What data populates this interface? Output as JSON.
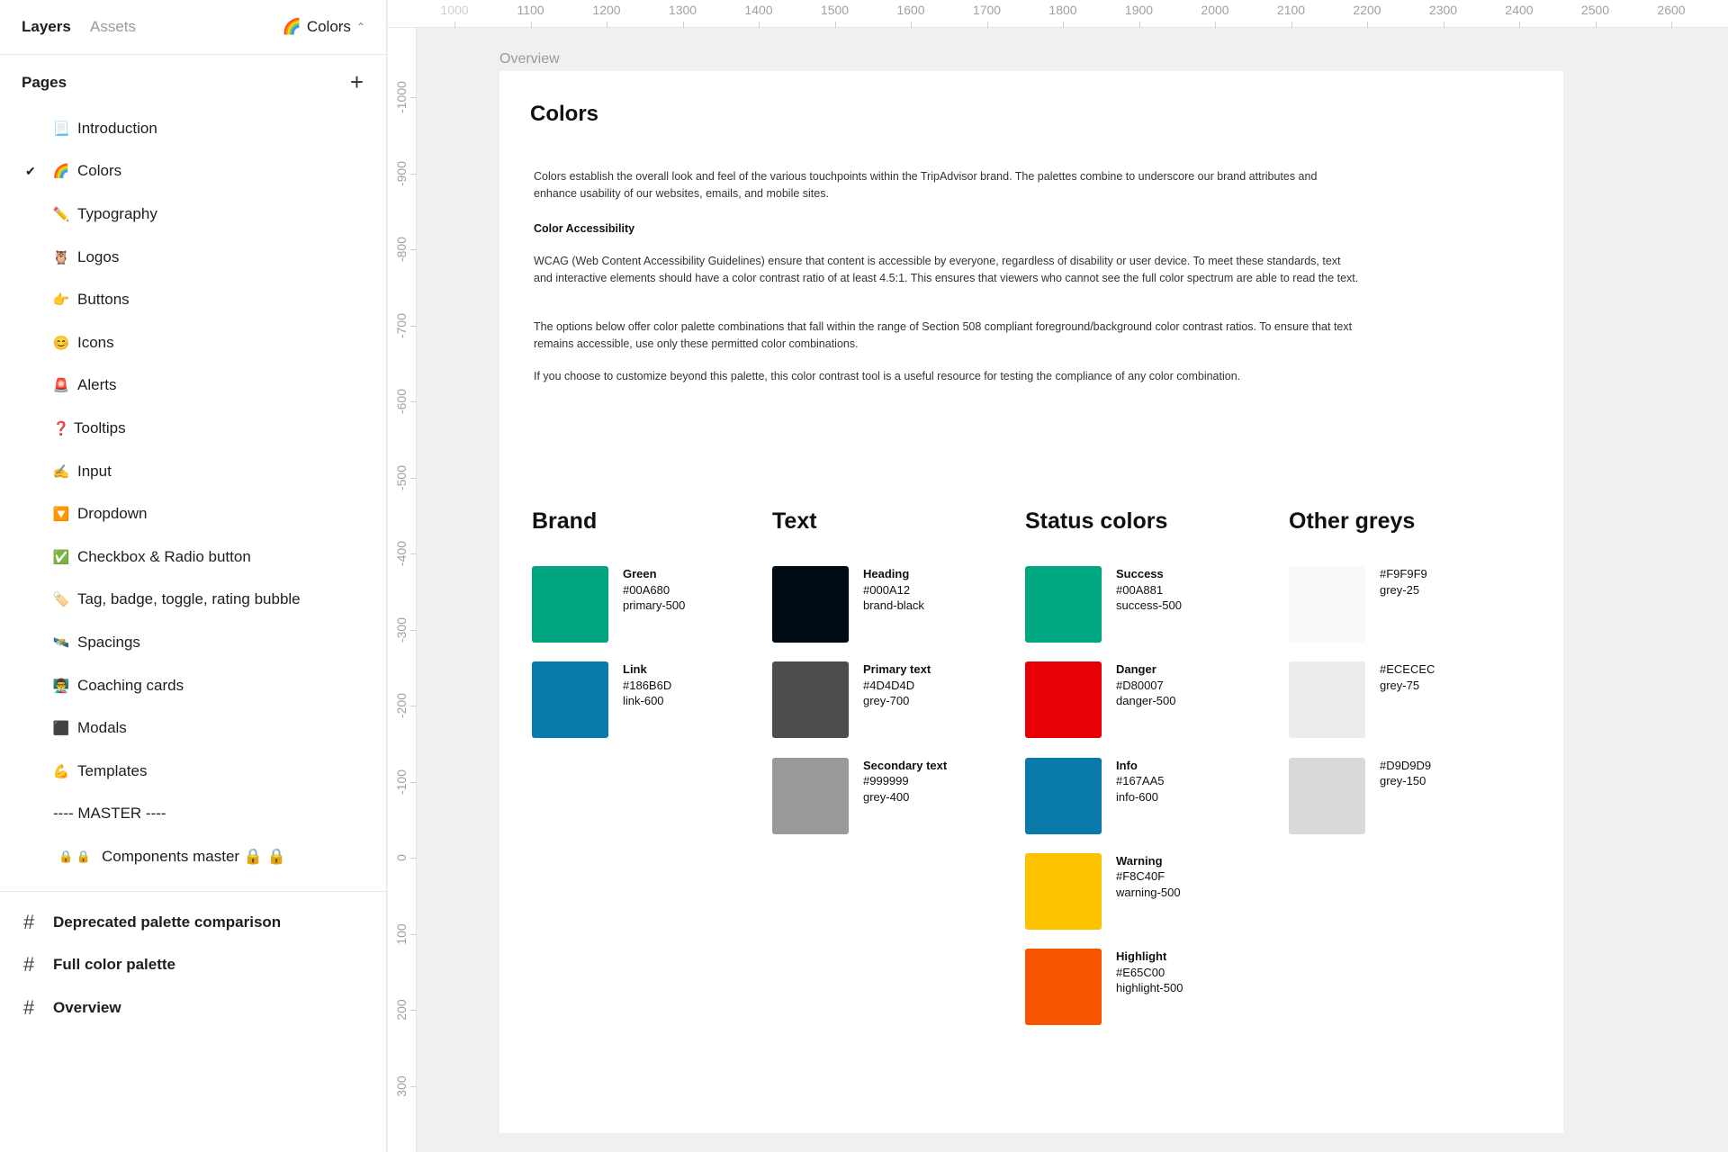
{
  "sidebar": {
    "tabs": {
      "layers": "Layers",
      "assets": "Assets"
    },
    "current_page": {
      "emoji": "🌈",
      "label": "Colors"
    },
    "pages_title": "Pages",
    "pages": [
      {
        "emoji": "📃",
        "label": "Introduction",
        "active": false
      },
      {
        "emoji": "🌈",
        "label": "Colors",
        "active": true
      },
      {
        "emoji": "✏️",
        "label": "Typography",
        "active": false
      },
      {
        "emoji": "🦉",
        "label": "Logos",
        "active": false
      },
      {
        "emoji": "👉",
        "label": "Buttons",
        "active": false
      },
      {
        "emoji": "😊",
        "label": "Icons",
        "active": false
      },
      {
        "emoji": "🚨",
        "label": "Alerts",
        "active": false
      },
      {
        "emoji": "❓",
        "label": "Tooltips",
        "active": false
      },
      {
        "emoji": "✍️",
        "label": "Input",
        "active": false
      },
      {
        "emoji": "🔽",
        "label": "Dropdown",
        "active": false
      },
      {
        "emoji": "✅",
        "label": "Checkbox & Radio button",
        "active": false
      },
      {
        "emoji": "🏷️",
        "label": "Tag, badge, toggle, rating bubble",
        "active": false
      },
      {
        "emoji": "🛰️",
        "label": "Spacings",
        "active": false
      },
      {
        "emoji": "👨‍🏫",
        "label": "Coaching cards",
        "active": false
      },
      {
        "emoji": "⬛",
        "label": "Modals",
        "active": false
      },
      {
        "emoji": "💪",
        "label": "Templates",
        "active": false
      },
      {
        "emoji": "",
        "label": "---- MASTER ----",
        "active": false
      },
      {
        "emoji": "🔒 🔒",
        "label": "Components master 🔒 🔒",
        "active": false
      }
    ],
    "frames": [
      {
        "label": "Deprecated palette comparison"
      },
      {
        "label": "Full color palette"
      },
      {
        "label": "Overview"
      }
    ]
  },
  "ruler": {
    "top": [
      "1000",
      "1100",
      "1200",
      "1300",
      "1400",
      "1500",
      "1600",
      "1700",
      "1800",
      "1900",
      "2000",
      "2100",
      "2200",
      "2300",
      "2400",
      "2500",
      "2600"
    ],
    "left": [
      "-1000",
      "-900",
      "-800",
      "-700",
      "-600",
      "-500",
      "-400",
      "-300",
      "-200",
      "-100",
      "0",
      "100",
      "200",
      "300"
    ]
  },
  "canvas": {
    "frame_label": "Overview",
    "title": "Colors",
    "paragraphs": {
      "intro": "Colors establish the overall look and feel of the various touchpoints within the TripAdvisor brand. The palettes combine to underscore our brand attributes and enhance usability of our websites, emails, and mobile sites.",
      "heading": "Color Accessibility",
      "wcag": "WCAG (Web Content Accessibility Guidelines) ensure that content is accessible by everyone, regardless of disability or user device. To meet these standards, text and interactive elements should have a color contrast ratio of at least 4.5:1. This ensures that viewers who cannot see the full color spectrum are able to read the text.",
      "options": "The options below offer color palette combinations that fall within the range of Section 508 compliant foreground/background color contrast ratios. To ensure that text remains accessible, use only these permitted color combinations.",
      "customize": "If you choose to customize beyond this palette, this color contrast tool is a useful resource for testing the compliance of any color combination."
    },
    "columns": [
      {
        "title": "Brand",
        "swatches": [
          {
            "name": "Green",
            "hex": "#00A680",
            "token": "primary-500",
            "color": "#00A680"
          },
          {
            "name": "Link",
            "hex": "#186B6D",
            "token": "link-600",
            "color": "#0A7AAA"
          }
        ]
      },
      {
        "title": "Text",
        "swatches": [
          {
            "name": "Heading",
            "hex": "#000A12",
            "token": "brand-black",
            "color": "#000A12"
          },
          {
            "name": "Primary text",
            "hex": "#4D4D4D",
            "token": "grey-700",
            "color": "#4D4D4D"
          },
          {
            "name": "Secondary text",
            "hex": "#999999",
            "token": "grey-400",
            "color": "#999999"
          }
        ]
      },
      {
        "title": "Status colors",
        "swatches": [
          {
            "name": "Success",
            "hex": "#00A881",
            "token": "success-500",
            "color": "#00A881"
          },
          {
            "name": "Danger",
            "hex": "#D80007",
            "token": "danger-500",
            "color": "#E80008"
          },
          {
            "name": "Info",
            "hex": "#167AA5",
            "token": "info-600",
            "color": "#0A7AAA"
          },
          {
            "name": "Warning",
            "hex": "#F8C40F",
            "token": "warning-500",
            "color": "#FDC300"
          },
          {
            "name": "Highlight",
            "hex": "#E65C00",
            "token": "highlight-500",
            "color": "#F85500"
          }
        ]
      },
      {
        "title": "Other greys",
        "swatches": [
          {
            "name": "",
            "hex": "#F9F9F9",
            "token": "grey-25",
            "color": "#F9F9F9"
          },
          {
            "name": "",
            "hex": "#ECECEC",
            "token": "grey-75",
            "color": "#ECECEC"
          },
          {
            "name": "",
            "hex": "#D9D9D9",
            "token": "grey-150",
            "color": "#D9D9D9"
          }
        ]
      }
    ]
  }
}
